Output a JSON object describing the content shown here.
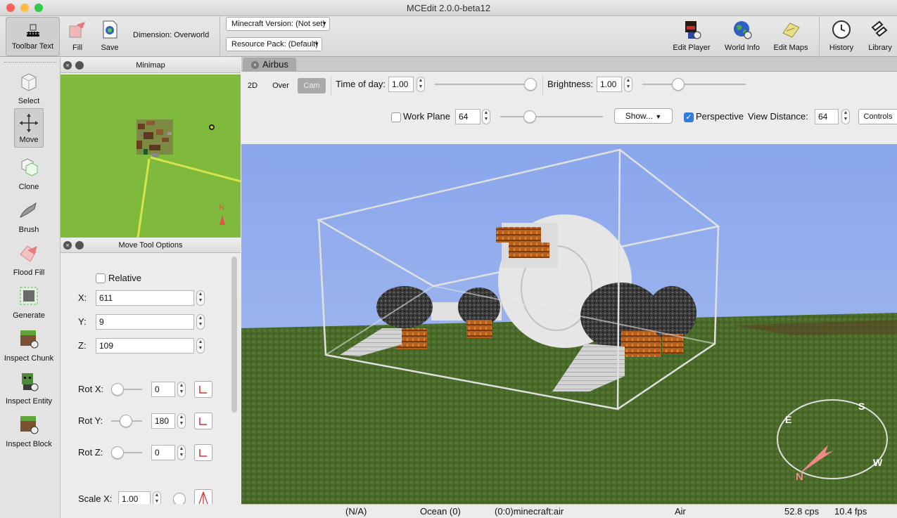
{
  "window": {
    "title": "MCEdit 2.0.0-beta12"
  },
  "toolbar": {
    "toolbar_text": "Toolbar Text",
    "fill": "Fill",
    "save": "Save",
    "dimension": "Dimension: Overworld",
    "mc_version": "Minecraft Version: (Not set)",
    "resource_pack": "Resource Pack: (Default)",
    "edit_player": "Edit Player",
    "world_info": "World Info",
    "edit_maps": "Edit Maps",
    "history": "History",
    "library": "Library"
  },
  "tools": {
    "select": "Select",
    "move": "Move",
    "clone": "Clone",
    "brush": "Brush",
    "flood_fill": "Flood Fill",
    "generate": "Generate",
    "inspect_chunk": "Inspect Chunk",
    "inspect_entity": "Inspect Entity",
    "inspect_block": "Inspect Block"
  },
  "minimap": {
    "title": "Minimap",
    "north": "N"
  },
  "move_options": {
    "title": "Move Tool Options",
    "relative_label": "Relative",
    "x_label": "X:",
    "x_value": "611",
    "y_label": "Y:",
    "y_value": "9",
    "z_label": "Z:",
    "z_value": "109",
    "rotx_label": "Rot X:",
    "rotx_value": "0",
    "roty_label": "Rot Y:",
    "roty_value": "180",
    "rotz_label": "Rot Z:",
    "rotz_value": "0",
    "scalex_label": "Scale X:",
    "scalex_value": "1.00"
  },
  "tab": {
    "label": "Airbus"
  },
  "view_controls": {
    "mode_2d": "2D",
    "mode_over": "Over",
    "mode_cam": "Cam",
    "time_label": "Time of day:",
    "time_value": "1.00",
    "brightness_label": "Brightness:",
    "brightness_value": "1.00",
    "workplane_label": "Work Plane",
    "workplane_value": "64",
    "show_label": "Show...",
    "perspective_label": "Perspective",
    "view_distance_label": "View Distance:",
    "view_distance_value": "64",
    "controls_label": "Controls"
  },
  "compass": {
    "n": "N",
    "e": "E",
    "s": "S",
    "w": "W"
  },
  "status": {
    "na": "(N/A)",
    "biome": "Ocean (0)",
    "block": "(0:0)minecraft:air",
    "material": "Air",
    "cps": "52.8 cps",
    "fps": "10.4 fps"
  },
  "colors": {
    "sky": "#8ca8ec",
    "ground": "#4a6a28",
    "minimap_grass": "#7fba3c",
    "accent_check": "#2f7de1"
  }
}
